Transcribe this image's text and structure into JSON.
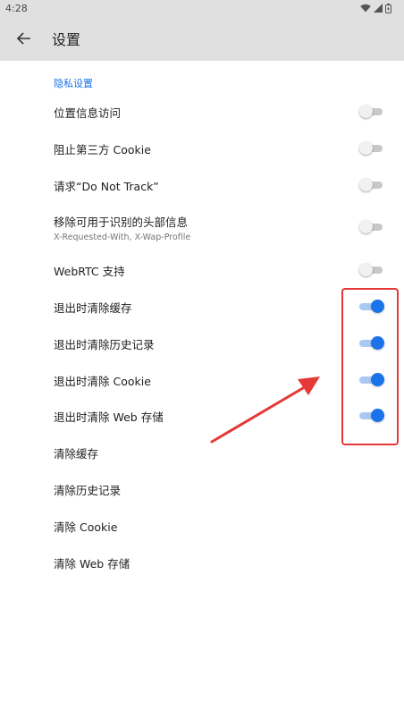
{
  "status_bar": {
    "time": "4:28"
  },
  "toolbar": {
    "title": "设置"
  },
  "section": {
    "header": "隐私设置"
  },
  "settings": [
    {
      "title": "位置信息访问",
      "subtitle": "",
      "toggle": true,
      "on": false
    },
    {
      "title": "阻止第三方 Cookie",
      "subtitle": "",
      "toggle": true,
      "on": false
    },
    {
      "title": "请求“Do Not Track”",
      "subtitle": "",
      "toggle": true,
      "on": false
    },
    {
      "title": "移除可用于识别的头部信息",
      "subtitle": "X-Requested-With, X-Wap-Profile",
      "toggle": true,
      "on": false
    },
    {
      "title": "WebRTC 支持",
      "subtitle": "",
      "toggle": true,
      "on": false
    },
    {
      "title": "退出时清除缓存",
      "subtitle": "",
      "toggle": true,
      "on": true
    },
    {
      "title": "退出时清除历史记录",
      "subtitle": "",
      "toggle": true,
      "on": true
    },
    {
      "title": "退出时清除 Cookie",
      "subtitle": "",
      "toggle": true,
      "on": true
    },
    {
      "title": "退出时清除 Web 存储",
      "subtitle": "",
      "toggle": true,
      "on": true
    },
    {
      "title": "清除缓存",
      "subtitle": "",
      "toggle": false,
      "on": false
    },
    {
      "title": "清除历史记录",
      "subtitle": "",
      "toggle": false,
      "on": false
    },
    {
      "title": "清除 Cookie",
      "subtitle": "",
      "toggle": false,
      "on": false
    },
    {
      "title": "清除 Web 存储",
      "subtitle": "",
      "toggle": false,
      "on": false
    }
  ],
  "colors": {
    "accent": "#1a73e8",
    "annotation": "#e53935",
    "toolbar_bg": "#e0e0e0"
  },
  "icons": {
    "back": "arrow-back-icon",
    "wifi": "wifi-icon",
    "signal": "cell-signal-icon",
    "battery": "battery-icon"
  }
}
